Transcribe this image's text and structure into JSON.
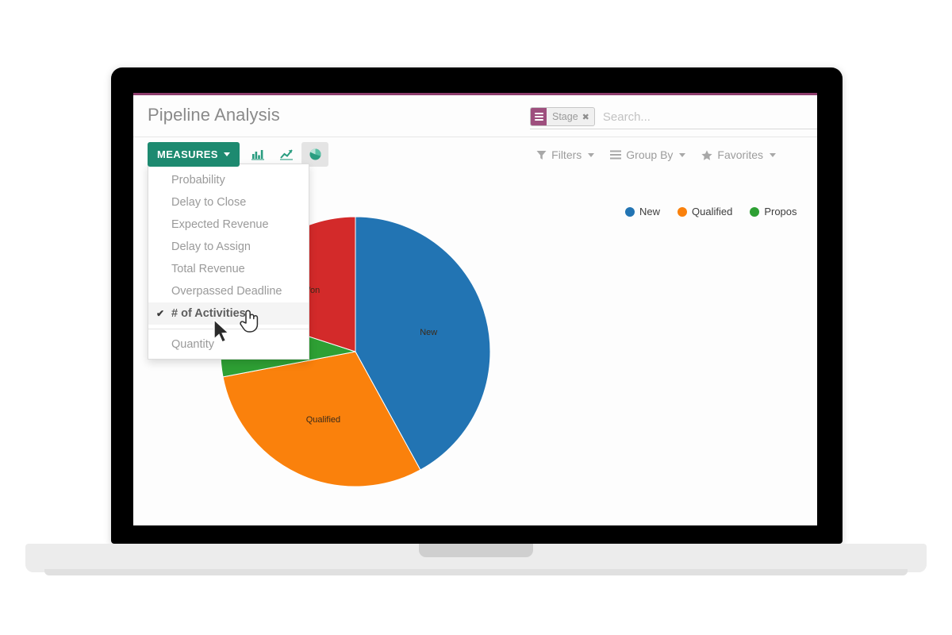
{
  "app": {
    "page_title": "Pipeline Analysis"
  },
  "search": {
    "facet_label": "Stage",
    "facet_remove_icon": "✖",
    "facet_icon": "list-icon",
    "placeholder": "Search...",
    "value": ""
  },
  "toolbar": {
    "measures_label": "MEASURES",
    "chart_types": [
      {
        "name": "bar-chart-icon",
        "label": "Bar Chart",
        "active": false
      },
      {
        "name": "line-chart-icon",
        "label": "Line Chart",
        "active": false
      },
      {
        "name": "pie-chart-icon",
        "label": "Pie Chart",
        "active": true
      }
    ],
    "filters_label": "Filters",
    "group_by_label": "Group By",
    "favorites_label": "Favorites"
  },
  "measures_menu": {
    "items": [
      {
        "label": "Probability",
        "checked": false
      },
      {
        "label": "Delay to Close",
        "checked": false
      },
      {
        "label": "Expected Revenue",
        "checked": false
      },
      {
        "label": "Delay to Assign",
        "checked": false
      },
      {
        "label": "Total Revenue",
        "checked": false
      },
      {
        "label": "Overpassed Deadline",
        "checked": false
      },
      {
        "label": "# of Activities",
        "checked": true
      }
    ],
    "check_glyph": "✔",
    "footer_items": [
      {
        "label": "Quantity",
        "checked": false
      }
    ]
  },
  "colors": {
    "brand_green": "#1d8a70",
    "accent_purple": "#8e3d6d",
    "facet_purple": "#9e4f7e",
    "blue": "#2274b3",
    "orange": "#fa810c",
    "green": "#2ea034",
    "red": "#d32a2a"
  },
  "chart_data": {
    "type": "pie",
    "title": "Pipeline Analysis",
    "measure": "# of Activities",
    "group_by": "Stage",
    "legend_position": "top-right",
    "legend_truncated": true,
    "categories": [
      "New",
      "Qualified",
      "Proposition",
      "Won"
    ],
    "labels_shown": [
      "New",
      "Qualified",
      "",
      "Won"
    ],
    "values": [
      42,
      30,
      8,
      20
    ],
    "colors": [
      "#2274b3",
      "#fa810c",
      "#2ea034",
      "#d32a2a"
    ],
    "legend": [
      {
        "label": "New",
        "color": "#2274b3"
      },
      {
        "label": "Qualified",
        "color": "#fa810c"
      },
      {
        "label": "Propos",
        "color": "#2ea034",
        "truncated": true
      }
    ]
  },
  "cursors": {
    "arrow": "arrow-pointer",
    "hand": "pointing-hand"
  }
}
